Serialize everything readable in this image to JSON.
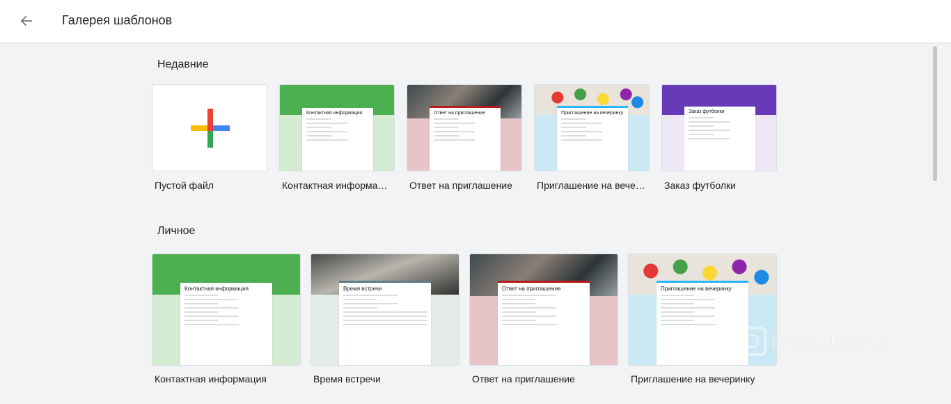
{
  "header": {
    "back_icon": "arrow-back-icon",
    "title": "Галерея шаблонов"
  },
  "sections": {
    "recent": {
      "title": "Недавние",
      "items": [
        {
          "label": "Пустой файл",
          "type": "blank"
        },
        {
          "label": "Контактная информа…",
          "form_title": "Контактная информация",
          "accent": "#4caf50"
        },
        {
          "label": "Ответ на приглашение",
          "form_title": "Ответ на приглашение",
          "accent": "#b71c1c"
        },
        {
          "label": "Приглашение на вече…",
          "form_title": "Приглашение на вечеринку",
          "accent": "#29b6f6"
        },
        {
          "label": "Заказ футболки",
          "form_title": "Заказ футболки",
          "accent": "#673ab7"
        }
      ]
    },
    "personal": {
      "title": "Личное",
      "items": [
        {
          "label": "Контактная информация",
          "form_title": "Контактная информация",
          "accent": "#4caf50"
        },
        {
          "label": "Время встречи",
          "form_title": "Время встречи",
          "accent": "#607d8b"
        },
        {
          "label": "Ответ на приглашение",
          "form_title": "Ответ на приглашение",
          "accent": "#b71c1c"
        },
        {
          "label": "Приглашение на вечеринку",
          "form_title": "Приглашение на вечеринку",
          "accent": "#29b6f6"
        }
      ]
    }
  },
  "watermark": "ПАРТНЕРКИН",
  "colors": {
    "background": "#f1f3f4",
    "green": "#4caf50",
    "green_light": "#d4ecd1",
    "pink": "#e7c4c7",
    "blue_light": "#cbe9f5",
    "purple": "#673ab7",
    "purple_light": "#ede7f6",
    "grey_light": "#e3eceb"
  }
}
